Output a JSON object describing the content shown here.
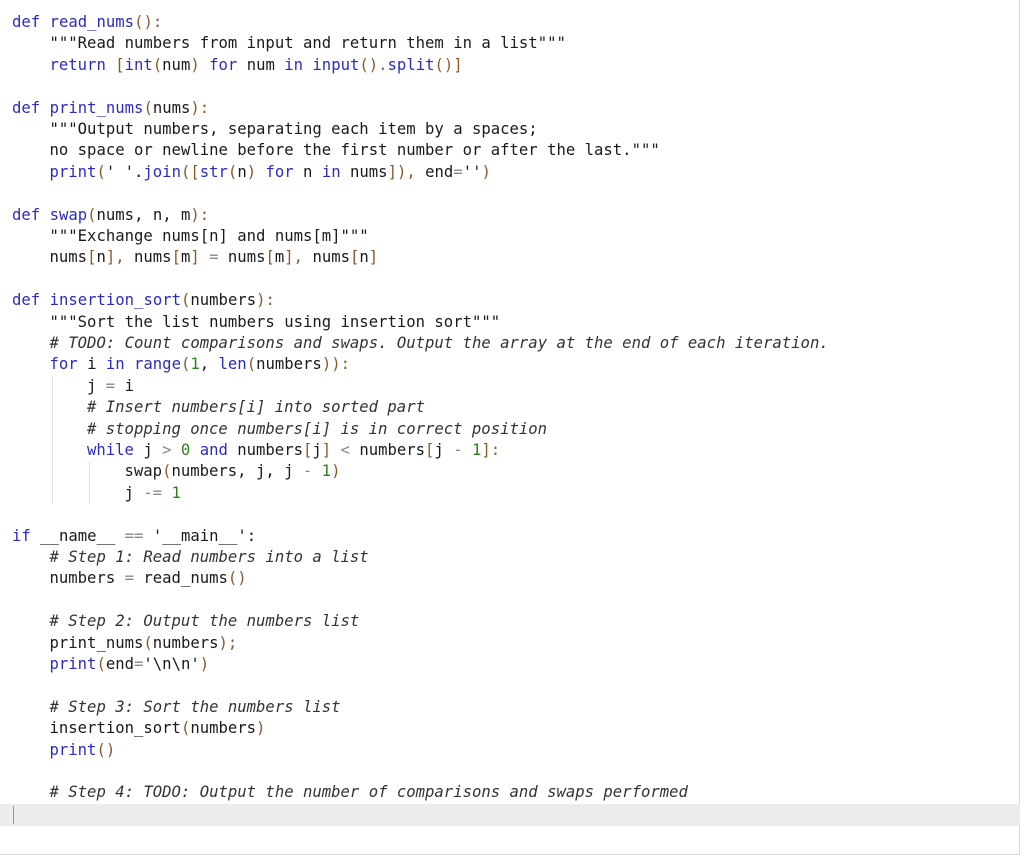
{
  "editor": {
    "language": "python",
    "lines": [
      {
        "indent": 0,
        "tokens": [
          {
            "t": "def ",
            "c": "kw"
          },
          {
            "t": "read_nums",
            "c": "fn"
          },
          {
            "t": "():",
            "c": "br"
          }
        ]
      },
      {
        "indent": 1,
        "tokens": [
          {
            "t": "\"\"\"Read numbers from input and return them in a list\"\"\"",
            "c": "str"
          }
        ]
      },
      {
        "indent": 1,
        "tokens": [
          {
            "t": "return ",
            "c": "kw"
          },
          {
            "t": "[",
            "c": "br"
          },
          {
            "t": "int",
            "c": "bi"
          },
          {
            "t": "(",
            "c": "br"
          },
          {
            "t": "num",
            "c": ""
          },
          {
            "t": ") ",
            "c": "br"
          },
          {
            "t": "for ",
            "c": "kw"
          },
          {
            "t": "num ",
            "c": ""
          },
          {
            "t": "in ",
            "c": "kw"
          },
          {
            "t": "input",
            "c": "bi"
          },
          {
            "t": "().",
            "c": "br"
          },
          {
            "t": "split",
            "c": "bi"
          },
          {
            "t": "()]",
            "c": "br"
          }
        ]
      },
      {
        "indent": 0,
        "tokens": []
      },
      {
        "indent": 0,
        "tokens": [
          {
            "t": "def ",
            "c": "kw"
          },
          {
            "t": "print_nums",
            "c": "fn"
          },
          {
            "t": "(",
            "c": "br"
          },
          {
            "t": "nums",
            "c": ""
          },
          {
            "t": "):",
            "c": "br"
          }
        ]
      },
      {
        "indent": 1,
        "tokens": [
          {
            "t": "\"\"\"Output numbers, separating each item by a spaces;",
            "c": "str"
          }
        ]
      },
      {
        "indent": 1,
        "tokens": [
          {
            "t": "no space or newline before the first number or after the last.\"\"\"",
            "c": "str"
          }
        ]
      },
      {
        "indent": 1,
        "tokens": [
          {
            "t": "print",
            "c": "bi"
          },
          {
            "t": "(",
            "c": "br"
          },
          {
            "t": "' '",
            "c": "str"
          },
          {
            "t": ".",
            "c": ""
          },
          {
            "t": "join",
            "c": "bi"
          },
          {
            "t": "([",
            "c": "br"
          },
          {
            "t": "str",
            "c": "bi"
          },
          {
            "t": "(",
            "c": "br"
          },
          {
            "t": "n",
            "c": ""
          },
          {
            "t": ") ",
            "c": "br"
          },
          {
            "t": "for ",
            "c": "kw"
          },
          {
            "t": "n ",
            "c": ""
          },
          {
            "t": "in ",
            "c": "kw"
          },
          {
            "t": "nums",
            "c": ""
          },
          {
            "t": "]), ",
            "c": "br"
          },
          {
            "t": "end",
            "c": ""
          },
          {
            "t": "=",
            "c": "op"
          },
          {
            "t": "''",
            "c": "str"
          },
          {
            "t": ")",
            "c": "br"
          }
        ]
      },
      {
        "indent": 0,
        "tokens": []
      },
      {
        "indent": 0,
        "tokens": [
          {
            "t": "def ",
            "c": "kw"
          },
          {
            "t": "swap",
            "c": "fn"
          },
          {
            "t": "(",
            "c": "br"
          },
          {
            "t": "nums, n, m",
            "c": ""
          },
          {
            "t": "):",
            "c": "br"
          }
        ]
      },
      {
        "indent": 1,
        "tokens": [
          {
            "t": "\"\"\"Exchange nums[n] and nums[m]\"\"\"",
            "c": "str"
          }
        ]
      },
      {
        "indent": 1,
        "tokens": [
          {
            "t": "nums",
            "c": ""
          },
          {
            "t": "[",
            "c": "br"
          },
          {
            "t": "n",
            "c": ""
          },
          {
            "t": "], ",
            "c": "br"
          },
          {
            "t": "nums",
            "c": ""
          },
          {
            "t": "[",
            "c": "br"
          },
          {
            "t": "m",
            "c": ""
          },
          {
            "t": "] ",
            "c": "br"
          },
          {
            "t": "= ",
            "c": "op"
          },
          {
            "t": "nums",
            "c": ""
          },
          {
            "t": "[",
            "c": "br"
          },
          {
            "t": "m",
            "c": ""
          },
          {
            "t": "], ",
            "c": "br"
          },
          {
            "t": "nums",
            "c": ""
          },
          {
            "t": "[",
            "c": "br"
          },
          {
            "t": "n",
            "c": ""
          },
          {
            "t": "]",
            "c": "br"
          }
        ]
      },
      {
        "indent": 0,
        "tokens": []
      },
      {
        "indent": 0,
        "tokens": [
          {
            "t": "def ",
            "c": "kw"
          },
          {
            "t": "insertion_sort",
            "c": "fn"
          },
          {
            "t": "(",
            "c": "br"
          },
          {
            "t": "numbers",
            "c": ""
          },
          {
            "t": "):",
            "c": "br"
          }
        ]
      },
      {
        "indent": 1,
        "tokens": [
          {
            "t": "\"\"\"Sort the list numbers using insertion sort\"\"\"",
            "c": "str"
          }
        ]
      },
      {
        "indent": 1,
        "tokens": [
          {
            "t": "# TODO: Count comparisons and swaps. Output the array at the end of each iteration.",
            "c": "cm"
          }
        ]
      },
      {
        "indent": 1,
        "tokens": [
          {
            "t": "for ",
            "c": "kw"
          },
          {
            "t": "i ",
            "c": ""
          },
          {
            "t": "in ",
            "c": "kw"
          },
          {
            "t": "range",
            "c": "bi"
          },
          {
            "t": "(",
            "c": "br"
          },
          {
            "t": "1",
            "c": "num"
          },
          {
            "t": ", ",
            "c": ""
          },
          {
            "t": "len",
            "c": "bi"
          },
          {
            "t": "(",
            "c": "br"
          },
          {
            "t": "numbers",
            "c": ""
          },
          {
            "t": ")):",
            "c": "br"
          }
        ]
      },
      {
        "indent": 2,
        "tokens": [
          {
            "t": "j ",
            "c": ""
          },
          {
            "t": "= ",
            "c": "op"
          },
          {
            "t": "i",
            "c": ""
          }
        ]
      },
      {
        "indent": 2,
        "tokens": [
          {
            "t": "# Insert numbers[i] into sorted part",
            "c": "cm"
          }
        ]
      },
      {
        "indent": 2,
        "tokens": [
          {
            "t": "# stopping once numbers[i] is in correct position",
            "c": "cm"
          }
        ]
      },
      {
        "indent": 2,
        "tokens": [
          {
            "t": "while ",
            "c": "kw"
          },
          {
            "t": "j ",
            "c": ""
          },
          {
            "t": "> ",
            "c": "op"
          },
          {
            "t": "0 ",
            "c": "num"
          },
          {
            "t": "and ",
            "c": "kw"
          },
          {
            "t": "numbers",
            "c": ""
          },
          {
            "t": "[",
            "c": "br"
          },
          {
            "t": "j",
            "c": ""
          },
          {
            "t": "] ",
            "c": "br"
          },
          {
            "t": "< ",
            "c": "op"
          },
          {
            "t": "numbers",
            "c": ""
          },
          {
            "t": "[",
            "c": "br"
          },
          {
            "t": "j ",
            "c": ""
          },
          {
            "t": "- ",
            "c": "op"
          },
          {
            "t": "1",
            "c": "num"
          },
          {
            "t": "]:",
            "c": "br"
          }
        ]
      },
      {
        "indent": 3,
        "tokens": [
          {
            "t": "swap",
            "c": ""
          },
          {
            "t": "(",
            "c": "br"
          },
          {
            "t": "numbers, j, j ",
            "c": ""
          },
          {
            "t": "- ",
            "c": "op"
          },
          {
            "t": "1",
            "c": "num"
          },
          {
            "t": ")",
            "c": "br"
          }
        ]
      },
      {
        "indent": 3,
        "tokens": [
          {
            "t": "j ",
            "c": ""
          },
          {
            "t": "-= ",
            "c": "op"
          },
          {
            "t": "1",
            "c": "num"
          }
        ]
      },
      {
        "indent": 0,
        "tokens": []
      },
      {
        "indent": 0,
        "tokens": [
          {
            "t": "if ",
            "c": "kw"
          },
          {
            "t": "__name__ ",
            "c": ""
          },
          {
            "t": "== ",
            "c": "op"
          },
          {
            "t": "'__main__'",
            "c": "str"
          },
          {
            "t": ":",
            "c": ""
          }
        ]
      },
      {
        "indent": 1,
        "tokens": [
          {
            "t": "# Step 1: Read numbers into a list",
            "c": "cm"
          }
        ]
      },
      {
        "indent": 1,
        "tokens": [
          {
            "t": "numbers ",
            "c": ""
          },
          {
            "t": "= ",
            "c": "op"
          },
          {
            "t": "read_nums",
            "c": ""
          },
          {
            "t": "()",
            "c": "br"
          }
        ]
      },
      {
        "indent": 0,
        "tokens": []
      },
      {
        "indent": 1,
        "tokens": [
          {
            "t": "# Step 2: Output the numbers list",
            "c": "cm"
          }
        ]
      },
      {
        "indent": 1,
        "tokens": [
          {
            "t": "print_nums",
            "c": ""
          },
          {
            "t": "(",
            "c": "br"
          },
          {
            "t": "numbers",
            "c": ""
          },
          {
            "t": ");",
            "c": "br"
          }
        ]
      },
      {
        "indent": 1,
        "tokens": [
          {
            "t": "print",
            "c": "bi"
          },
          {
            "t": "(",
            "c": "br"
          },
          {
            "t": "end",
            "c": ""
          },
          {
            "t": "=",
            "c": "op"
          },
          {
            "t": "'\\n\\n'",
            "c": "str"
          },
          {
            "t": ")",
            "c": "br"
          }
        ]
      },
      {
        "indent": 0,
        "tokens": []
      },
      {
        "indent": 1,
        "tokens": [
          {
            "t": "# Step 3: Sort the numbers list",
            "c": "cm"
          }
        ]
      },
      {
        "indent": 1,
        "tokens": [
          {
            "t": "insertion_sort",
            "c": ""
          },
          {
            "t": "(",
            "c": "br"
          },
          {
            "t": "numbers",
            "c": ""
          },
          {
            "t": ")",
            "c": "br"
          }
        ]
      },
      {
        "indent": 1,
        "tokens": [
          {
            "t": "print",
            "c": "bi"
          },
          {
            "t": "()",
            "c": "br"
          }
        ]
      },
      {
        "indent": 0,
        "tokens": []
      },
      {
        "indent": 1,
        "tokens": [
          {
            "t": "# Step 4: TODO: Output the number of comparisons and swaps performed",
            "c": "cm"
          }
        ]
      }
    ]
  },
  "colors": {
    "keyword": "#2b2bc0",
    "number": "#2e7d1f",
    "operator": "#888888",
    "active_line": "#ececec"
  }
}
